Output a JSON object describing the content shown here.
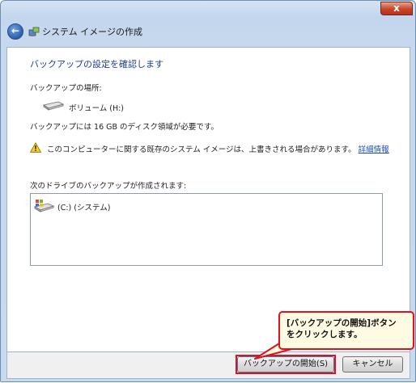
{
  "window": {
    "title": "システム イメージの作成",
    "close_glyph": "x"
  },
  "content": {
    "heading": "バックアップの設定を確認します",
    "location_label": "バックアップの場所:",
    "drive_name": "ボリューム (H:)",
    "space_required": "バックアップには 16 GB のディスク領域が必要です。",
    "warning_text": "このコンピューターに関する既存のシステム イメージは、上書きされる場合があります。",
    "warning_link": "詳細情報",
    "drives_label": "次のドライブのバックアップが作成されます:",
    "drives_list": [
      {
        "label": "(C:) (システム)",
        "icon": "system-drive-icon"
      }
    ]
  },
  "buttons": {
    "start_backup": "バックアップの開始(S)",
    "cancel": "キャンセル"
  },
  "callout": {
    "line1": "[バックアップの開始]ボタン",
    "line2": "をクリックします。"
  },
  "colors": {
    "accent_red": "#e0101c",
    "heading_blue": "#1e3f8a",
    "link_blue": "#1c4fc4"
  }
}
